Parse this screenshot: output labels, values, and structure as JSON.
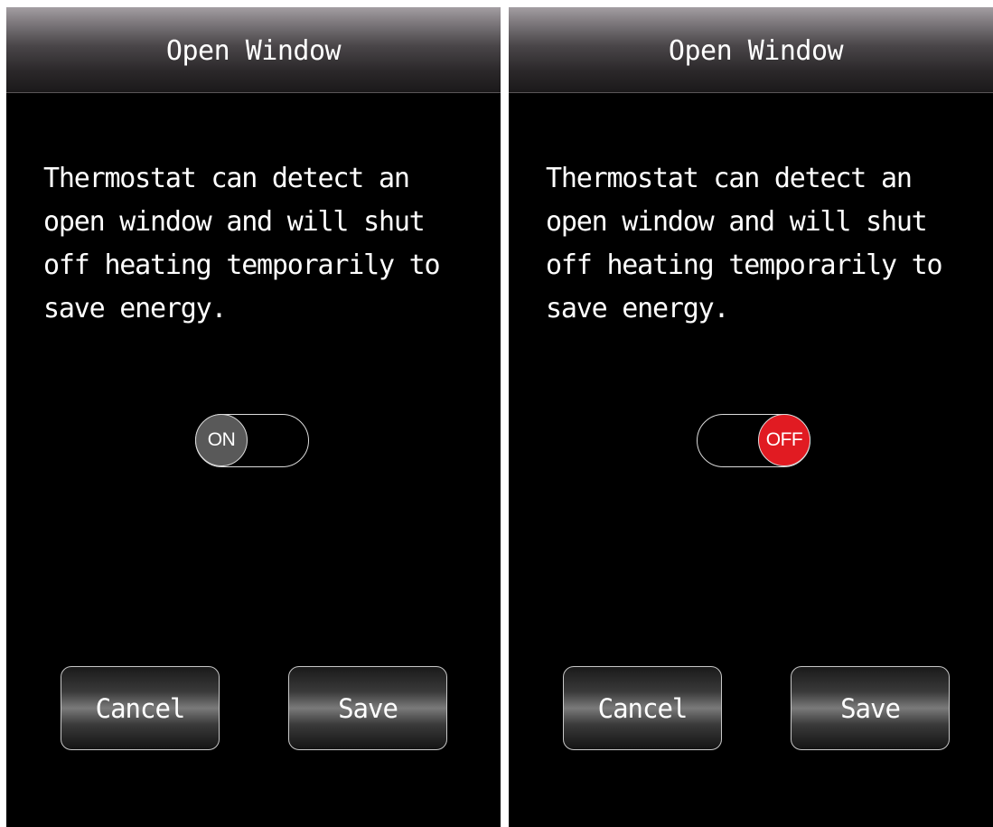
{
  "screens": [
    {
      "title": "Open Window",
      "description": "Thermostat can detect an open window and will shut off heating temporarily to save energy.",
      "toggle": {
        "state": "on",
        "label": "ON",
        "color": "#595959"
      },
      "cancel_label": "Cancel",
      "save_label": "Save"
    },
    {
      "title": "Open Window",
      "description": "Thermostat can detect an open window and will shut off heating temporarily to save energy.",
      "toggle": {
        "state": "off",
        "label": "OFF",
        "color": "#e11b22"
      },
      "cancel_label": "Cancel",
      "save_label": "Save"
    }
  ]
}
